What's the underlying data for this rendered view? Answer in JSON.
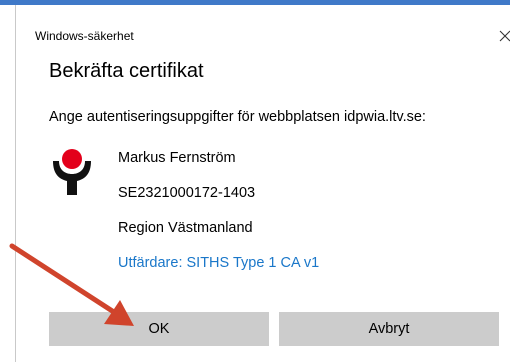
{
  "window": {
    "title": "Windows-säkerhet",
    "close_icon": "close-icon"
  },
  "dialog": {
    "heading": "Bekräfta certifikat",
    "prompt": "Ange autentiseringsuppgifter för webbplatsen idpwia.ltv.se:"
  },
  "certificate": {
    "icon": "certificate-logo-icon",
    "name": "Markus Fernström",
    "id": "SE2321000172-1403",
    "organization": "Region Västmanland",
    "issuer_link": "Utfärdare: SITHS Type 1 CA v1"
  },
  "buttons": {
    "ok_label": "OK",
    "cancel_label": "Avbryt"
  },
  "colors": {
    "accent": "#3f79c8",
    "link": "#1a77c9",
    "button": "#cccccc",
    "logo_red": "#e3001b",
    "arrow": "#d0442c"
  }
}
